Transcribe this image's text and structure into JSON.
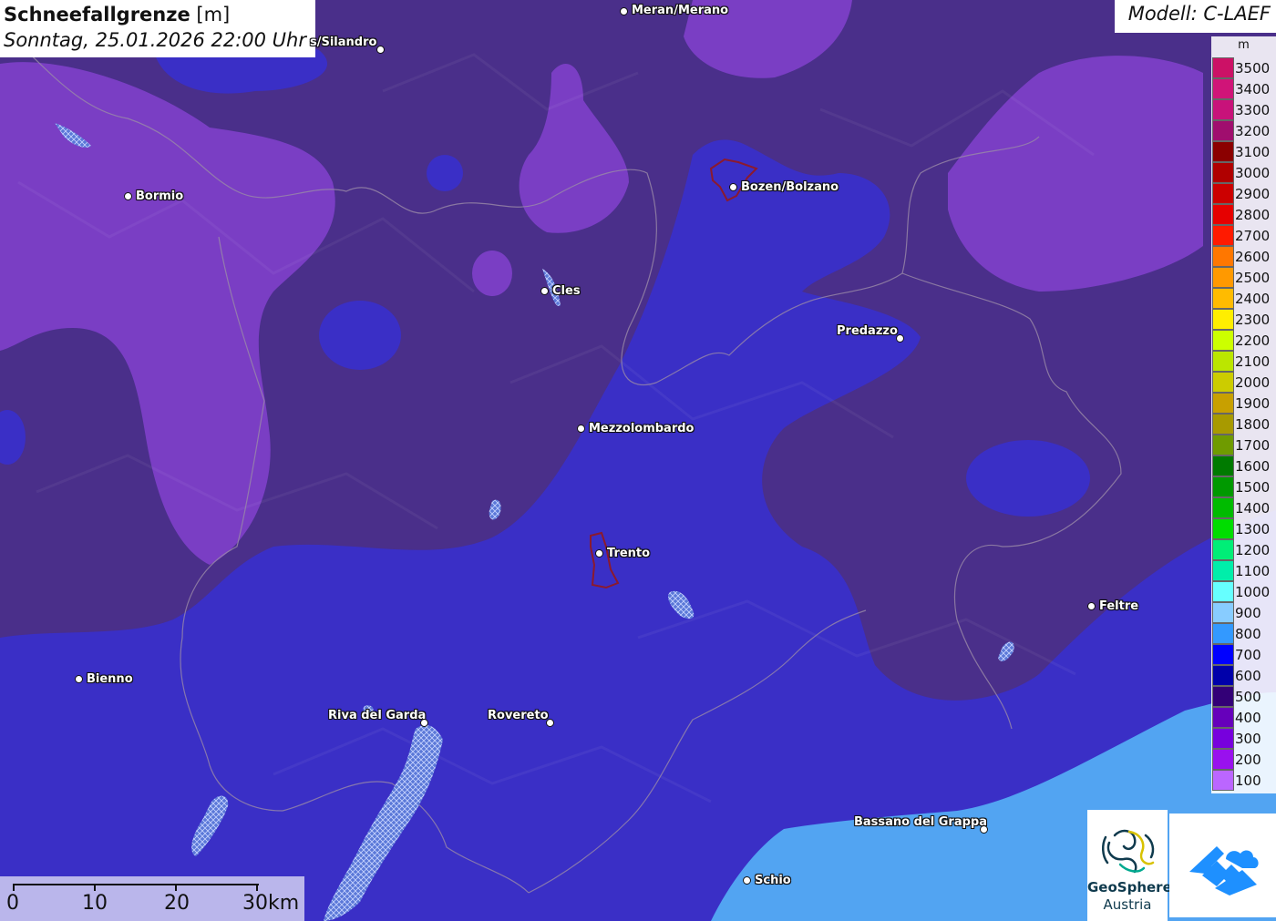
{
  "title": {
    "main": "Schneefallgrenze",
    "unit": "[m]",
    "datetime": "Sonntag, 25.01.2026 22:00 Uhr"
  },
  "model_label": "Modell: C-LAEF",
  "legend": {
    "unit": "m",
    "items": [
      {
        "label": "3500",
        "color": "#cc1166"
      },
      {
        "label": "3400",
        "color": "#d01478"
      },
      {
        "label": "3300",
        "color": "#c8127a"
      },
      {
        "label": "3200",
        "color": "#a00e6e"
      },
      {
        "label": "3100",
        "color": "#8b0000"
      },
      {
        "label": "3000",
        "color": "#b00000"
      },
      {
        "label": "2900",
        "color": "#cc0000"
      },
      {
        "label": "2800",
        "color": "#e60000"
      },
      {
        "label": "2700",
        "color": "#ff1a00"
      },
      {
        "label": "2600",
        "color": "#ff7700"
      },
      {
        "label": "2500",
        "color": "#ff9900"
      },
      {
        "label": "2400",
        "color": "#ffbb00"
      },
      {
        "label": "2300",
        "color": "#ffee00"
      },
      {
        "label": "2200",
        "color": "#ccff00"
      },
      {
        "label": "2100",
        "color": "#bbe600"
      },
      {
        "label": "2000",
        "color": "#cccc00"
      },
      {
        "label": "1900",
        "color": "#c8a000"
      },
      {
        "label": "1800",
        "color": "#a89a00"
      },
      {
        "label": "1700",
        "color": "#6f9b00"
      },
      {
        "label": "1600",
        "color": "#007a00"
      },
      {
        "label": "1500",
        "color": "#009900"
      },
      {
        "label": "1400",
        "color": "#00bb00"
      },
      {
        "label": "1300",
        "color": "#00dd00"
      },
      {
        "label": "1200",
        "color": "#00ee77"
      },
      {
        "label": "1100",
        "color": "#00eeaa"
      },
      {
        "label": "1000",
        "color": "#66ffff"
      },
      {
        "label": "900",
        "color": "#88ccff"
      },
      {
        "label": "800",
        "color": "#3399ff"
      },
      {
        "label": "700",
        "color": "#0000ff"
      },
      {
        "label": "600",
        "color": "#0000aa"
      },
      {
        "label": "500",
        "color": "#330077"
      },
      {
        "label": "400",
        "color": "#6600bb"
      },
      {
        "label": "300",
        "color": "#7700dd"
      },
      {
        "label": "200",
        "color": "#9911ee"
      },
      {
        "label": "100",
        "color": "#bb66ff"
      }
    ]
  },
  "cities": [
    {
      "name": "Meran/Merano"
    },
    {
      "name": "s/Silandro"
    },
    {
      "name": "Bormio"
    },
    {
      "name": "Bozen/Bolzano"
    },
    {
      "name": "Cles"
    },
    {
      "name": "Predazzo"
    },
    {
      "name": "Mezzolombardo"
    },
    {
      "name": "Trento"
    },
    {
      "name": "Feltre"
    },
    {
      "name": "Bienno"
    },
    {
      "name": "Riva del Garda"
    },
    {
      "name": "Rovereto"
    },
    {
      "name": "Bassano del Grappa"
    },
    {
      "name": "Schio"
    }
  ],
  "scale_bar": {
    "labels": [
      "0",
      "10",
      "20",
      "30km"
    ]
  },
  "logos": {
    "geosphere_line1": "GeoSphere",
    "geosphere_line2": "Austria"
  },
  "colors": {
    "violet": "#4a2f8a",
    "purple": "#7a3ec4",
    "blue": "#3a2fc6",
    "light_blue": "#52a4f2"
  }
}
